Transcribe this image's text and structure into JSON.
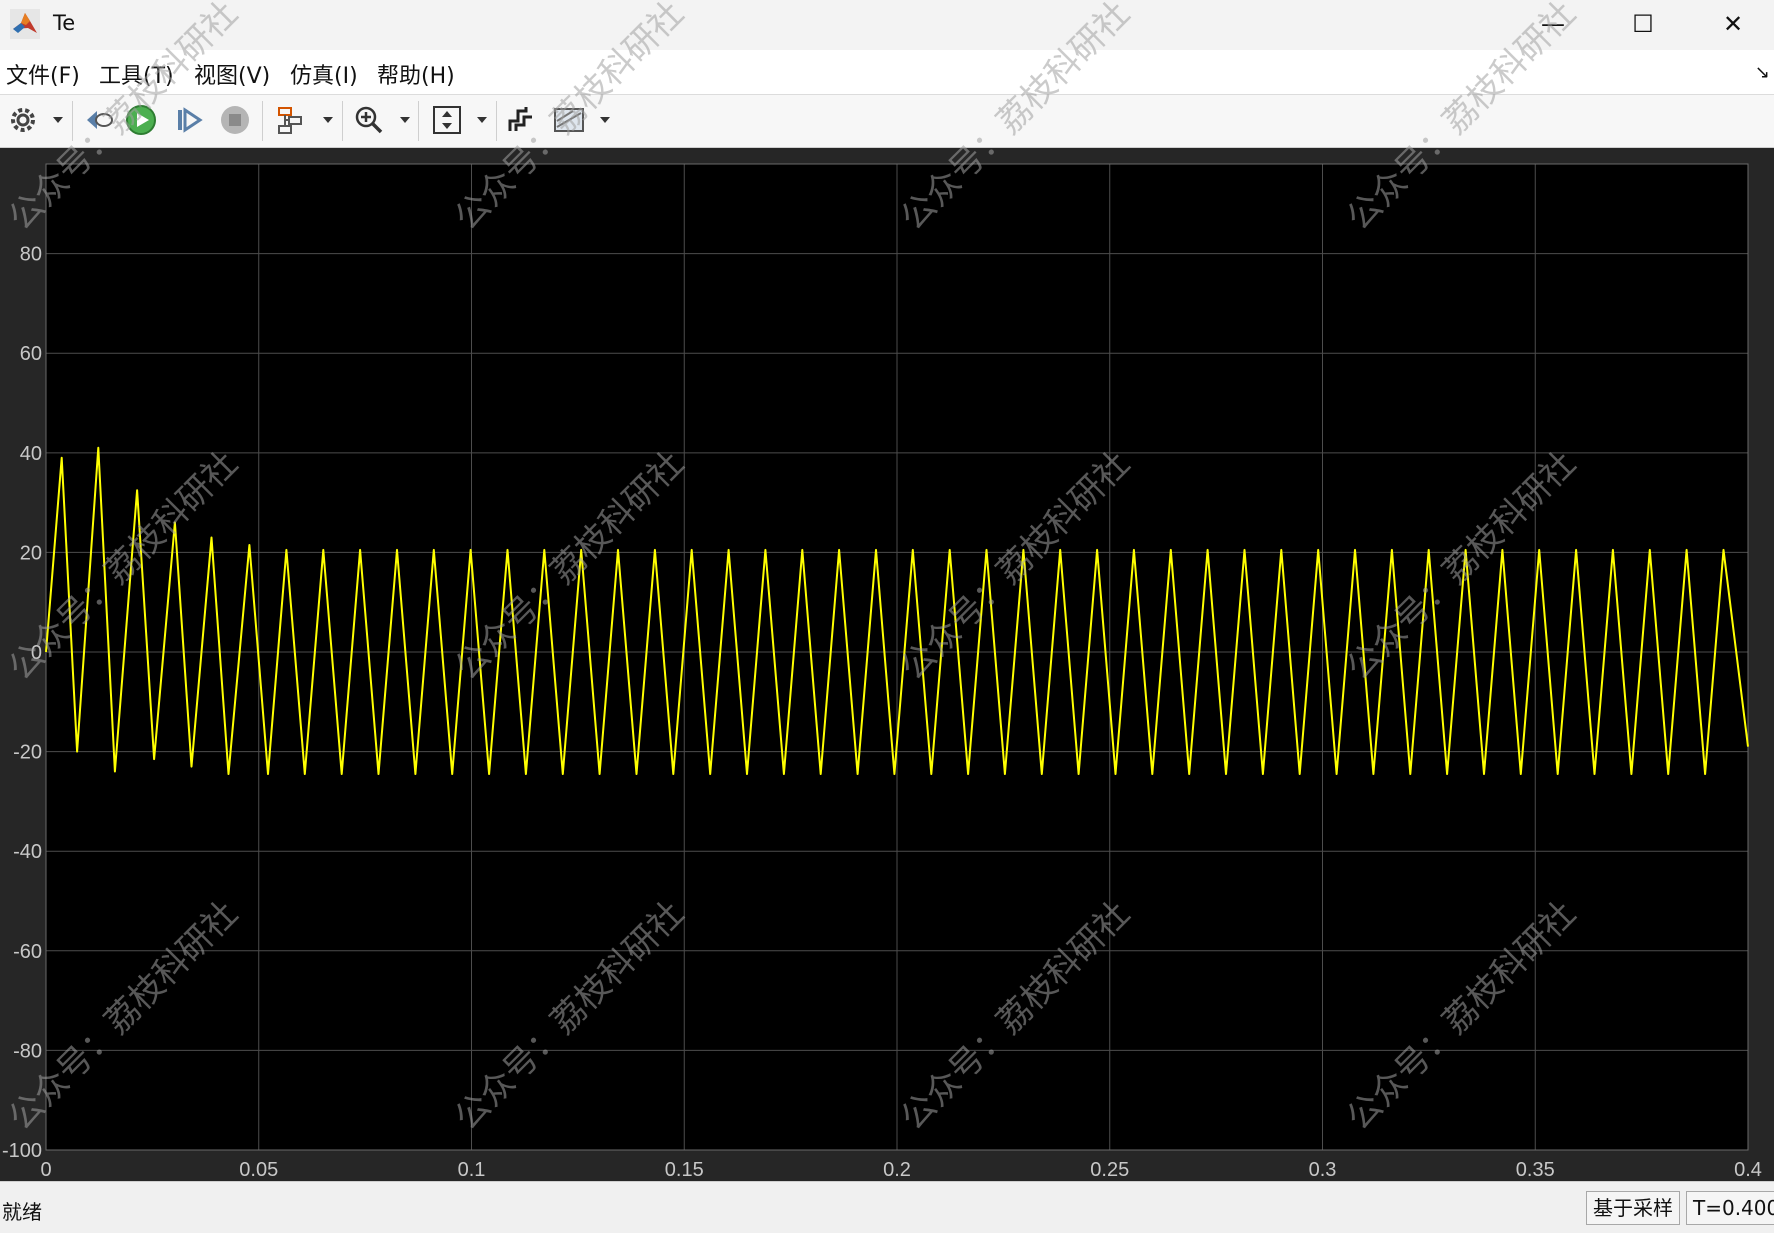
{
  "window": {
    "title": "Te",
    "minimize": "—",
    "maximize": "☐",
    "close": "✕"
  },
  "menu": [
    "文件(F)",
    "工具(T)",
    "视图(V)",
    "仿真(I)",
    "帮助(H)"
  ],
  "toolbar": {
    "icons": [
      "gear-icon",
      "step-back-icon",
      "run-icon",
      "step-forward-icon",
      "stop-icon",
      "layout-icon",
      "zoom-in-icon",
      "scale-axes-icon",
      "signal-icon",
      "style-icon"
    ]
  },
  "colors": {
    "trace": "#ffff00",
    "plot_bg": "#000000",
    "panel_bg": "#262626",
    "grid": "#4d4d4d",
    "tick_text": "#c8c8c8"
  },
  "chart_data": {
    "type": "line",
    "title": "",
    "xlabel": "",
    "ylabel": "",
    "xlim": [
      0,
      0.4
    ],
    "ylim": [
      -100,
      98
    ],
    "grid": true,
    "xticks": [
      "0",
      "0.05",
      "0.1",
      "0.15",
      "0.2",
      "0.25",
      "0.3",
      "0.35",
      "0.4"
    ],
    "yticks": [
      "80",
      "60",
      "40",
      "20",
      "0",
      "-20",
      "-40",
      "-60",
      "-80",
      "-100"
    ],
    "series": [
      {
        "color": "#ffff00",
        "peaks": [
          {
            "t": 0.0037,
            "max": 39
          },
          {
            "t": 0.0123,
            "max": 41
          },
          {
            "t": 0.0214,
            "max": 32.5
          },
          {
            "t": 0.0303,
            "max": 26
          },
          {
            "t": 0.0389,
            "max": 23
          },
          {
            "t": 0.0478,
            "max": 21.5
          }
        ],
        "troughs": [
          {
            "t": 0.0073,
            "min": -20
          },
          {
            "t": 0.0162,
            "min": -24
          },
          {
            "t": 0.0254,
            "min": -21.5
          },
          {
            "t": 0.0342,
            "min": -23
          },
          {
            "t": 0.0429,
            "min": -24.5
          }
        ],
        "steady": {
          "period": 0.00866,
          "max": 20.5,
          "min": -24.5,
          "first_peak_t": 0.0565
        },
        "end": {
          "t": 0.4,
          "value": -19
        }
      }
    ]
  },
  "status": {
    "left": "就绪",
    "mode": "基于采样",
    "time": "T=0.400"
  },
  "watermark": "公众号：荔枝科研社"
}
